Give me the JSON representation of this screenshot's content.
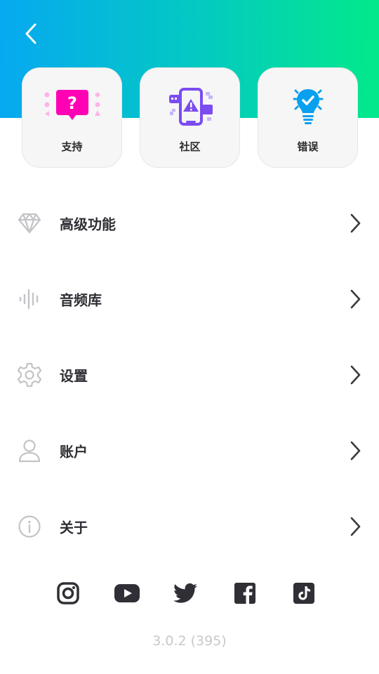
{
  "header": {
    "back_icon": "chevron-left-icon",
    "gradient_colors": [
      "#06a9f0",
      "#03e98a"
    ]
  },
  "cards": [
    {
      "label": "支持",
      "icon": "support-question-icon",
      "color": "#ff00b4"
    },
    {
      "label": "社区",
      "icon": "community-phone-icon",
      "color": "#7b4cf0"
    },
    {
      "label": "错误",
      "icon": "bug-lightbulb-icon",
      "color": "#0aa0f0"
    }
  ],
  "menu": [
    {
      "label": "高级功能",
      "icon": "diamond-icon"
    },
    {
      "label": "音频库",
      "icon": "audio-wave-icon"
    },
    {
      "label": "设置",
      "icon": "gear-icon"
    },
    {
      "label": "账户",
      "icon": "user-icon"
    },
    {
      "label": "关于",
      "icon": "info-icon"
    }
  ],
  "social": [
    {
      "icon": "instagram-icon"
    },
    {
      "icon": "youtube-icon"
    },
    {
      "icon": "twitter-icon"
    },
    {
      "icon": "facebook-icon"
    },
    {
      "icon": "tiktok-icon"
    }
  ],
  "footer": {
    "version": "3.0.2 (395)"
  },
  "colors": {
    "menu_icon": "#c4c4c8",
    "text": "#2f2f35",
    "social_icon": "#2f2f35"
  }
}
